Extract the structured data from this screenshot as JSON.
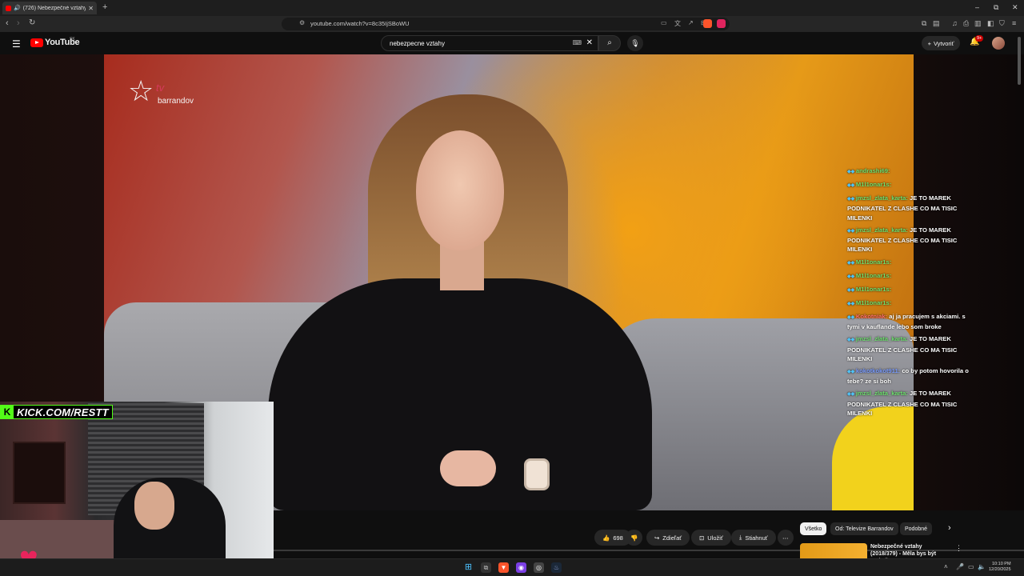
{
  "browser": {
    "tab_title": "(726) Nebezpečné vztahy (20...",
    "url": "youtube.com/watch?v=8c35IjSBoWU",
    "notif_count": "9+"
  },
  "masthead": {
    "logo": "YouTube",
    "country": "SK",
    "search_value": "nebezpecne vztahy",
    "create_label": "Vytvoriť"
  },
  "video": {
    "brand_tv": "tv",
    "brand_name": "barrandov"
  },
  "chat": [
    {
      "user": "andrashi69:",
      "text": "",
      "color": "green"
    },
    {
      "user": "M1l1onar1s:",
      "text": "",
      "color": "green"
    },
    {
      "user": "jmzsl_zlata_karta:",
      "text": "JE TO MAREK PODNIKATEL Z CLASHE CO MA TISIC MILENKI",
      "color": "green"
    },
    {
      "user": "jmzsl_zlata_karta:",
      "text": "JE TO MAREK PODNIKATEL Z CLASHE CO MA TISIC MILENKI",
      "color": "green"
    },
    {
      "user": "M1l1onar1s:",
      "text": "",
      "color": "green"
    },
    {
      "user": "M1l1onar1s:",
      "text": "",
      "color": "green"
    },
    {
      "user": "M1l1onar1s:",
      "text": "",
      "color": "green"
    },
    {
      "user": "M1l1onar1s:",
      "text": "",
      "color": "green"
    },
    {
      "user": "Kokotniak:",
      "text": "aj ja pracujem s akciami. s tymi v kauflande lebo som broke",
      "color": "red"
    },
    {
      "user": "jmzsl_zlata_karta:",
      "text": "JE TO MAREK PODNIKATEL Z CLASHE CO MA TISIC MILENKI",
      "color": "green"
    },
    {
      "user": "kokotkokot911:",
      "text": "co by potom hovorila o tebe? ze si boh",
      "color": "blue"
    },
    {
      "user": "jmzsl_zlata_karta:",
      "text": "JE TO MAREK PODNIKATEL Z CLASHE CO MA TISIC MILENKI",
      "color": "green"
    }
  ],
  "overlay": {
    "kick_label": "KICK.COM/RESTT",
    "kick_logo": "K"
  },
  "actions": {
    "like_count": "698",
    "share_label": "Zdieľať",
    "save_label": "Uložiť",
    "download_label": "Stiahnuť"
  },
  "chips": [
    "Všetko",
    "Od: Televize Barrandov",
    "Podobné"
  ],
  "recommendation": {
    "title": "Nebezpečné vztahy (2018/379) - Měla bys být moje žena"
  },
  "taskbar": {
    "time": "10:10 PM",
    "date": "12/20/2025"
  }
}
